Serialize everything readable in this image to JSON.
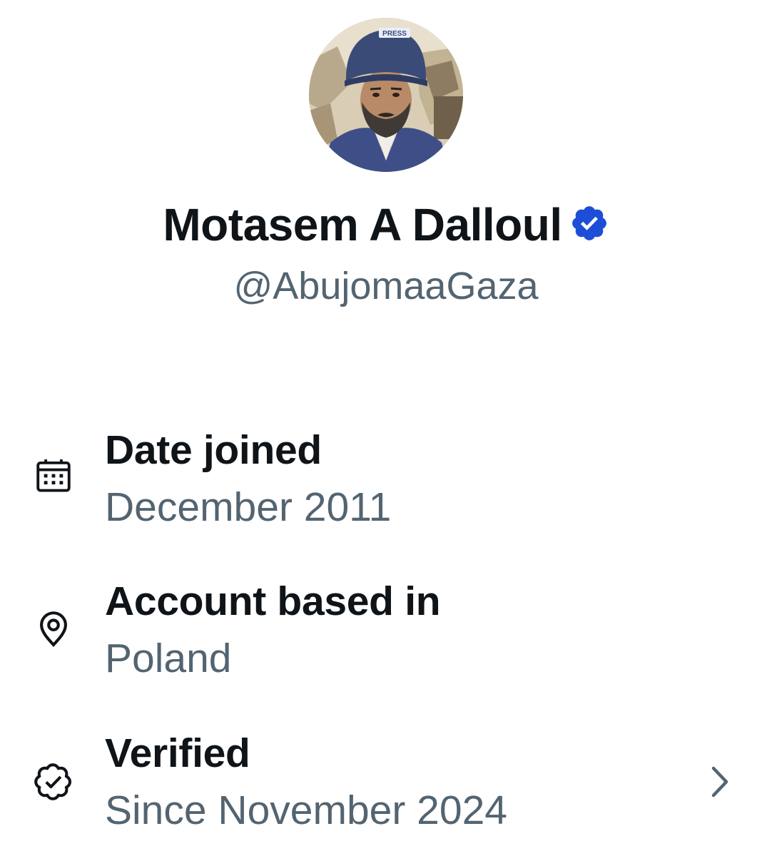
{
  "profile": {
    "display_name": "Motasem A Dalloul",
    "handle": "@AbujomaaGaza",
    "avatar_icon": "avatar-photo",
    "verified_badge_icon": "verified-badge-icon",
    "avatar_helmet_text": "PRESS"
  },
  "about": {
    "items": [
      {
        "icon": "calendar-icon",
        "title": "Date joined",
        "value": "December 2011"
      },
      {
        "icon": "location-pin-icon",
        "title": "Account based in",
        "value": "Poland"
      },
      {
        "icon": "verified-outline-icon",
        "title": "Verified",
        "value": "Since November 2024",
        "chevron_icon": "chevron-right-icon"
      }
    ]
  },
  "colors": {
    "primary_text": "#0f1419",
    "secondary_text": "#536471",
    "badge_blue": "#1d9bf0",
    "background": "#ffffff"
  }
}
